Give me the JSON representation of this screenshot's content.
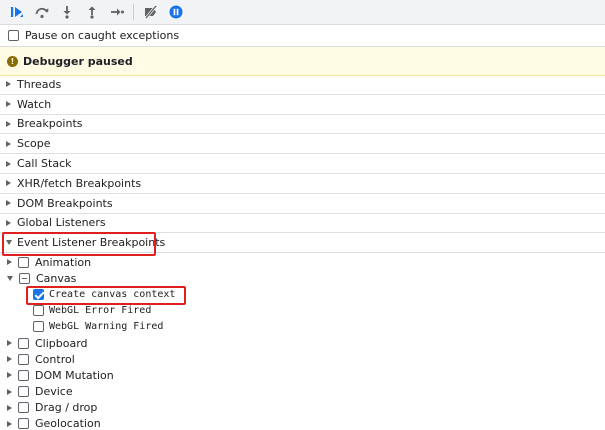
{
  "toolbar": {
    "icons": [
      "resume-icon",
      "step-over-icon",
      "step-into-icon",
      "step-out-icon",
      "step-icon",
      "deactivate-breakpoints-icon",
      "pause-on-exceptions-icon"
    ],
    "accent": "#1a73e8"
  },
  "pause_caught": {
    "label": "Pause on caught exceptions",
    "checked": false
  },
  "banner": {
    "text": "Debugger paused",
    "icon": "warning-icon"
  },
  "sections": [
    {
      "label": "Threads"
    },
    {
      "label": "Watch"
    },
    {
      "label": "Breakpoints"
    },
    {
      "label": "Scope"
    },
    {
      "label": "Call Stack"
    },
    {
      "label": "XHR/fetch Breakpoints"
    },
    {
      "label": "DOM Breakpoints"
    },
    {
      "label": "Global Listeners"
    },
    {
      "label": "Event Listener Breakpoints"
    }
  ],
  "events": {
    "animation": "Animation",
    "canvas": "Canvas",
    "canvas_items": [
      "Create canvas context",
      "WebGL Error Fired",
      "WebGL Warning Fired"
    ],
    "rest": [
      "Clipboard",
      "Control",
      "DOM Mutation",
      "Device",
      "Drag / drop",
      "Geolocation"
    ]
  }
}
